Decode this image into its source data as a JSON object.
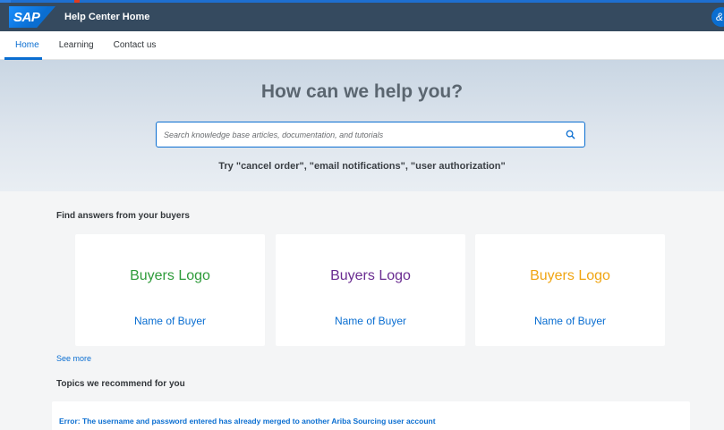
{
  "shell": {
    "logo_text": "SAP",
    "title": "Help Center Home",
    "user_initial": "&"
  },
  "tabs": [
    {
      "label": "Home",
      "active": true
    },
    {
      "label": "Learning",
      "active": false
    },
    {
      "label": "Contact us",
      "active": false
    }
  ],
  "hero": {
    "title": "How can we help you?",
    "search_placeholder": "Search knowledge base articles, documentation, and tutorials",
    "hint": "Try  \"cancel order\", \"email notifications\", \"user authorization\""
  },
  "buyers_section": {
    "title": "Find answers from your buyers",
    "cards": [
      {
        "logo": "Buyers Logo",
        "logo_color": "#2e9b3a",
        "name": "Name of Buyer"
      },
      {
        "logo": "Buyers Logo",
        "logo_color": "#6a2c91",
        "name": "Name of Buyer"
      },
      {
        "logo": "Buyers Logo",
        "logo_color": "#f0a512",
        "name": "Name of Buyer"
      }
    ],
    "see_more": "See more"
  },
  "topics_section": {
    "title": "Topics we recommend for you",
    "items": [
      {
        "label": "Error: The username and password entered has already merged to another Ariba Sourcing user account"
      }
    ]
  },
  "colors": {
    "accent": "#0a6ed1",
    "shell": "#354a5f"
  }
}
